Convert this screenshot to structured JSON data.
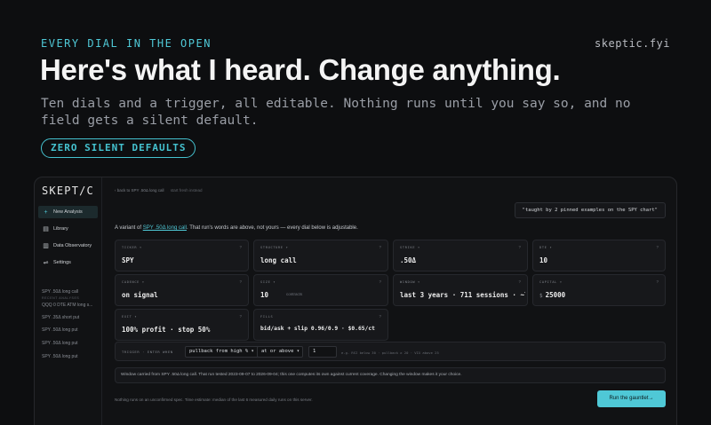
{
  "hero": {
    "eyebrow": "EVERY DIAL IN THE OPEN",
    "brand": "skeptic.fyi",
    "headline": "Here's what I heard. Change anything.",
    "subhead": "Ten dials and a trigger, all editable. Nothing runs until you say so, and no field gets a silent default.",
    "pill": "ZERO SILENT DEFAULTS"
  },
  "sidebar": {
    "logo": "SKEPT/C",
    "nav": [
      {
        "label": "New Analysis",
        "icon": "plus-icon"
      },
      {
        "label": "Library",
        "icon": "library-icon"
      },
      {
        "label": "Data Observatory",
        "icon": "chart-icon"
      },
      {
        "label": "Settings",
        "icon": "sliders-icon"
      }
    ],
    "recent_heading": "RECENT ANALYSES",
    "recent": [
      "SPY .50Δ long call",
      "QQQ 0 DTE ATM long s...",
      "SPY .35Δ short put",
      "SPY .50Δ long put",
      "SPY .50Δ long put",
      "SPY .50Δ long put"
    ]
  },
  "main": {
    "breadcrumb": "‹ back to SPY .50Δ long call",
    "start_fresh": "start fresh instead",
    "quote": "\"taught by 2 pinned examples on the SPY chart\"",
    "variant_prefix": "A variant of",
    "variant_link": "SPY .50Δ long call",
    "variant_suffix": ". That run's words are above, not yours — every dial below is adjustable."
  },
  "dials": {
    "ticker": {
      "label": "TICKER ▾",
      "q": "?",
      "value": "SPY"
    },
    "structure": {
      "label": "STRUCTURE ▾",
      "q": "?",
      "value": "long call"
    },
    "strike": {
      "label": "STRIKE ▾",
      "q": "?",
      "value": ".50Δ"
    },
    "dte": {
      "label": "DTE ▾",
      "q": "?",
      "value": "10"
    },
    "cadence": {
      "label": "CADENCE ▾",
      "q": "?",
      "value": "on signal"
    },
    "size": {
      "label": "SIZE ▾",
      "q": "?",
      "value": "10",
      "unit": "contracts"
    },
    "window": {
      "label": "WINDOW ▾",
      "q": "?",
      "value": "last 3 years · 711 sessions · ~7:"
    },
    "capital": {
      "label": "CAPITAL ▾",
      "q": "?",
      "prefix": "$",
      "value": "25000"
    },
    "exit": {
      "label": "EXIT ▾",
      "q": "?",
      "value": "100% profit · stop 50%"
    },
    "fills": {
      "label": "FILLS",
      "q": "?",
      "value": "bid/ask + slip 0.96/0.9 · $0.65/ct"
    }
  },
  "trigger": {
    "label": "TRIGGER · ENTER WHEN",
    "metric": "pullback from high % ▾",
    "operator": "at or above ▾",
    "threshold": "1",
    "hint": "e.g. RSI below 30 · pullback ≥ 20 · VIX above 25"
  },
  "notice": "Window carried from SPY .50Δ long call. That run tested 2023-09-07 to 2026-09-04; this one computes its own against current coverage. Changing the window makes it your choice.",
  "footnote": "Nothing runs on an unconfirmed spec. Time estimate: median of the last 6 measured daily runs on this server.",
  "run_button": "Run the gauntlet→",
  "colors": {
    "accent": "#4fc8d6",
    "background": "#0d0e10",
    "panel": "#17181b"
  }
}
